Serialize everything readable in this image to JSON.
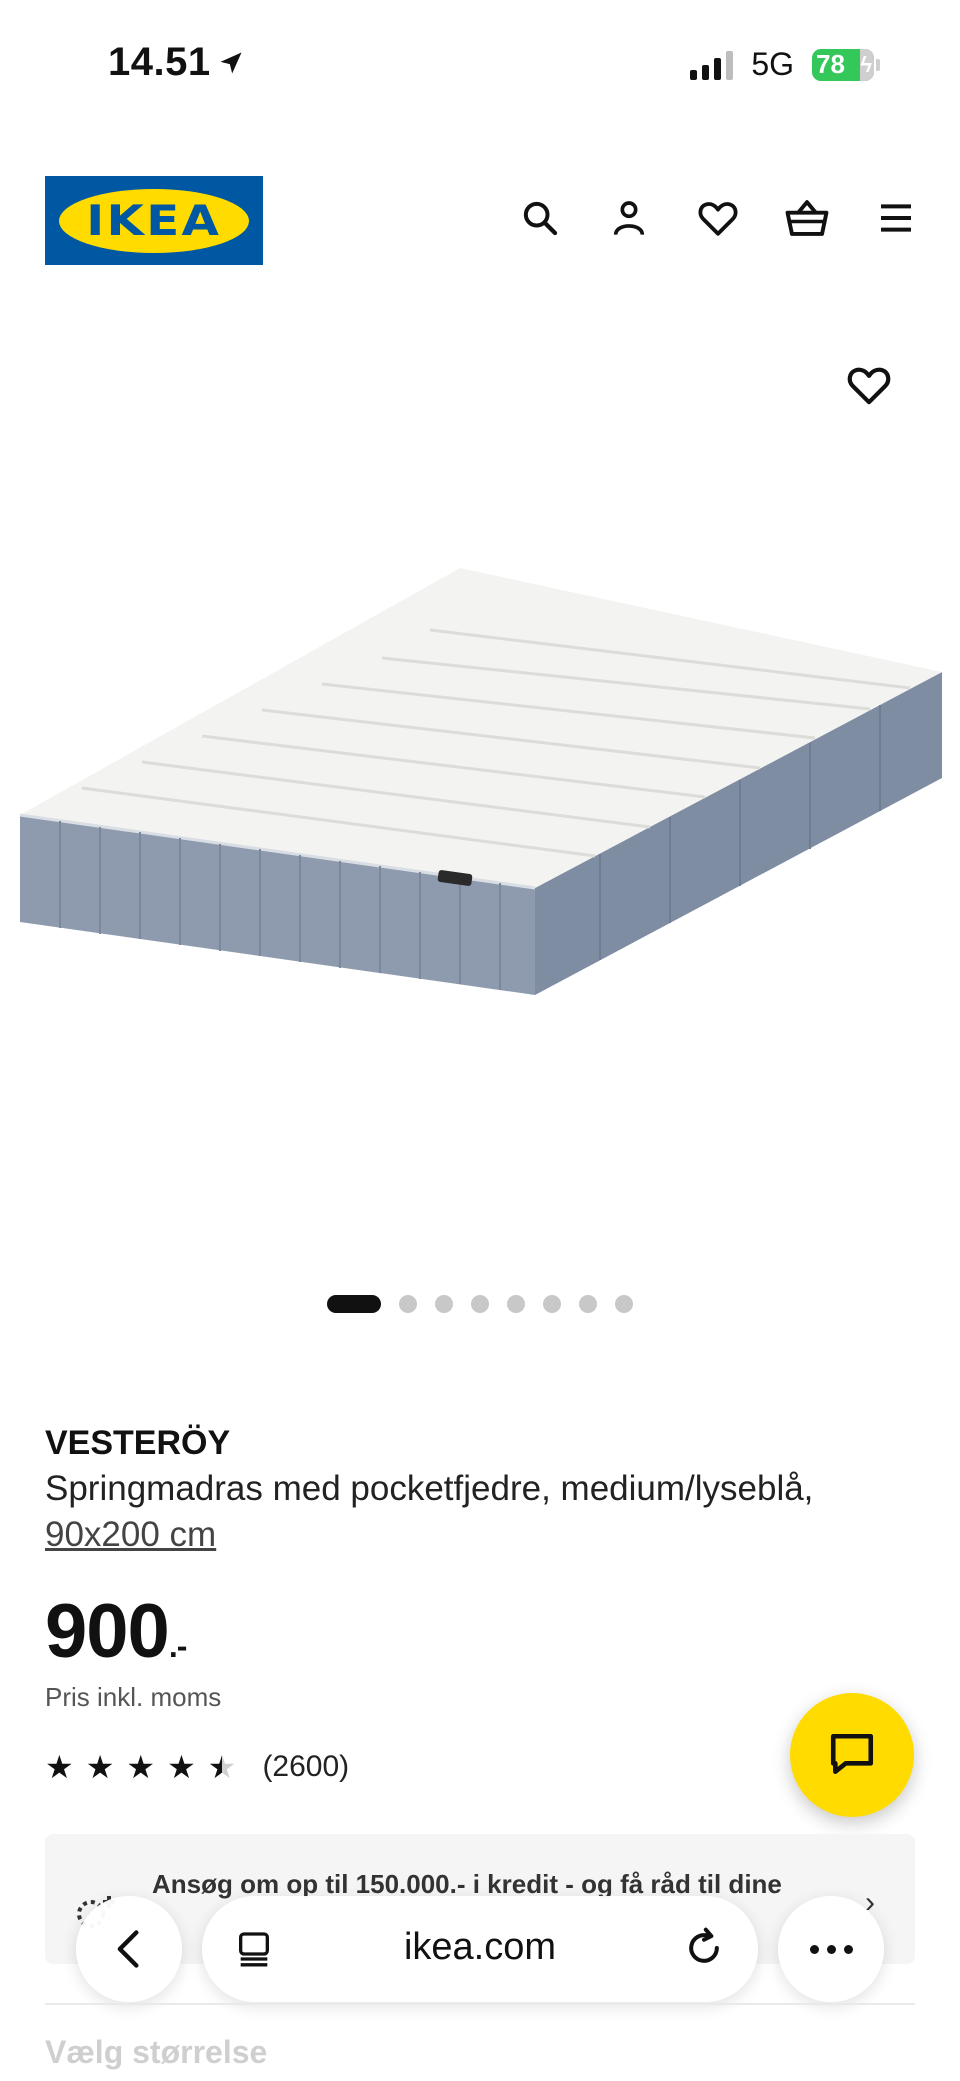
{
  "status_bar": {
    "time": "14.51",
    "network": "5G",
    "battery": "78"
  },
  "header": {
    "logo_text": "IKEA",
    "icons": [
      "search-icon",
      "account-icon",
      "favorites-icon",
      "basket-icon",
      "menu-icon"
    ]
  },
  "gallery": {
    "image_count": 8,
    "active_index": 0
  },
  "product": {
    "name": "VESTERÖY",
    "description": "Springmadras med pocketfjedre, medium/lyseblå,",
    "size": "90x200 cm",
    "price": "900",
    "price_suffix": ".-",
    "price_note": "Pris inkl. moms",
    "rating": 4.5,
    "rating_max": 5,
    "review_count": "(2600)"
  },
  "credit_banner": {
    "text": "Ansøg om op til 150.000.- i kredit - og få råd til dine"
  },
  "browser": {
    "url": "ikea.com"
  },
  "size_section": {
    "heading": "Vælg størrelse"
  },
  "colors": {
    "ikea_blue": "#0058a3",
    "ikea_yellow": "#ffdb00",
    "mattress_side": "#8e9bae",
    "mattress_top": "#f3f3f1"
  }
}
